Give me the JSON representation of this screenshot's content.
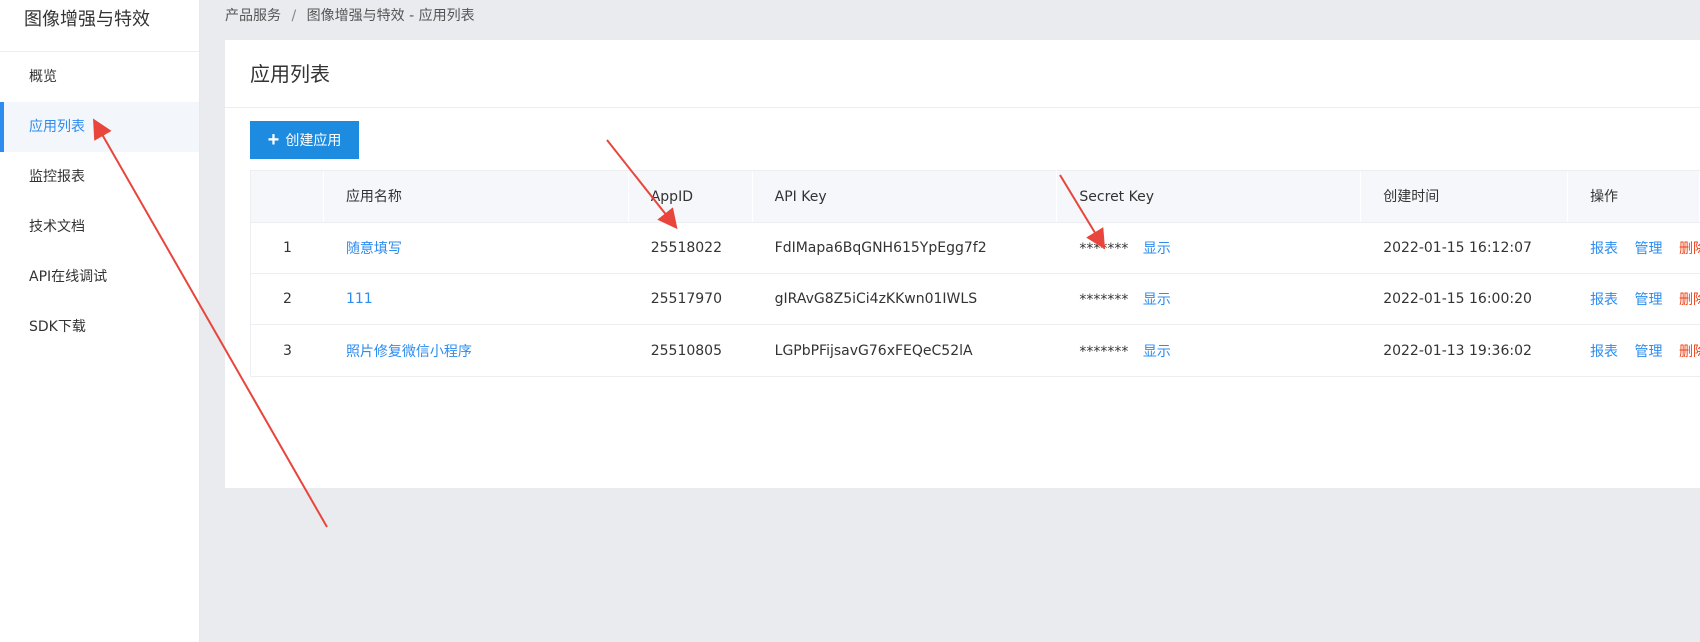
{
  "sidebar": {
    "title": "图像增强与特效",
    "items": [
      {
        "label": "概览"
      },
      {
        "label": "应用列表"
      },
      {
        "label": "监控报表"
      },
      {
        "label": "技术文档"
      },
      {
        "label": "API在线调试"
      },
      {
        "label": "SDK下载"
      }
    ]
  },
  "breadcrumb": {
    "root": "产品服务",
    "separator": "/",
    "current": "图像增强与特效 - 应用列表"
  },
  "panel": {
    "title": "应用列表",
    "create_button": "创建应用"
  },
  "table": {
    "headers": {
      "name": "应用名称",
      "appid": "AppID",
      "apikey": "API Key",
      "secret": "Secret Key",
      "time": "创建时间",
      "ops": "操作"
    },
    "rows": [
      {
        "index": "1",
        "name": "随意填写",
        "appid": "25518022",
        "apikey": "FdIMapa6BqGNH615YpEgg7f2",
        "secret_mask": "*******",
        "show": "显示",
        "time": "2022-01-15 16:12:07",
        "op_report": "报表",
        "op_manage": "管理",
        "op_delete": "删除"
      },
      {
        "index": "2",
        "name": "111",
        "appid": "25517970",
        "apikey": "gIRAvG8Z5iCi4zKKwn01IWLS",
        "secret_mask": "*******",
        "show": "显示",
        "time": "2022-01-15 16:00:20",
        "op_report": "报表",
        "op_manage": "管理",
        "op_delete": "删除"
      },
      {
        "index": "3",
        "name": "照片修复微信小程序",
        "appid": "25510805",
        "apikey": "LGPbPFijsavG76xFEQeC52lA",
        "secret_mask": "*******",
        "show": "显示",
        "time": "2022-01-13 19:36:02",
        "op_report": "报表",
        "op_manage": "管理",
        "op_delete": "删除"
      }
    ]
  },
  "colors": {
    "accent": "#2d8cf0",
    "button": "#1d8ce0",
    "danger": "#ed3f14",
    "annotation": "#e8453c"
  }
}
